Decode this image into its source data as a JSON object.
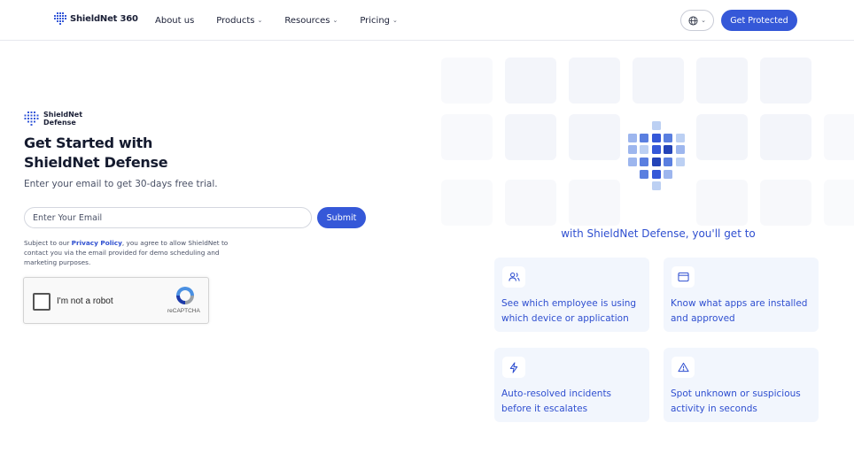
{
  "header": {
    "brand": "ShieldNet 360",
    "nav": [
      {
        "label": "About us",
        "has_menu": false
      },
      {
        "label": "Products",
        "has_menu": true
      },
      {
        "label": "Resources",
        "has_menu": true
      },
      {
        "label": "Pricing",
        "has_menu": true
      }
    ],
    "language_icon": "globe-icon",
    "cta_label": "Get Protected"
  },
  "form": {
    "product_brand_line1": "ShieldNet",
    "product_brand_line2": "Defense",
    "title_line1": "Get Started with",
    "title_line2": "ShieldNet Defense",
    "subtitle": "Enter your email to get 30-days free trial.",
    "email_placeholder": "Enter Your Email",
    "email_value": "",
    "submit_label": "Submit",
    "legal_prefix": "Subject to our ",
    "legal_link": "Privacy Policy",
    "legal_suffix": ", you agree to allow ShieldNet to contact you via the email provided for demo scheduling and marketing purposes.",
    "captcha_label": "I'm not a robot",
    "captcha_brand": "reCAPTCHA"
  },
  "benefits": {
    "title": "with ShieldNet Defense, you'll get to",
    "cards": [
      {
        "icon": "users-icon",
        "text": "See which employee is using which device or application"
      },
      {
        "icon": "browser-window-icon",
        "text": "Know what apps are installed and approved"
      },
      {
        "icon": "lightning-icon",
        "text": "Auto-resolved incidents before it escalates"
      },
      {
        "icon": "warning-triangle-icon",
        "text": "Spot unknown or suspicious activity in seconds"
      }
    ]
  },
  "colors": {
    "accent": "#3558d8",
    "accent_text": "#2f4fd0",
    "card_bg": "#f2f6fd"
  }
}
